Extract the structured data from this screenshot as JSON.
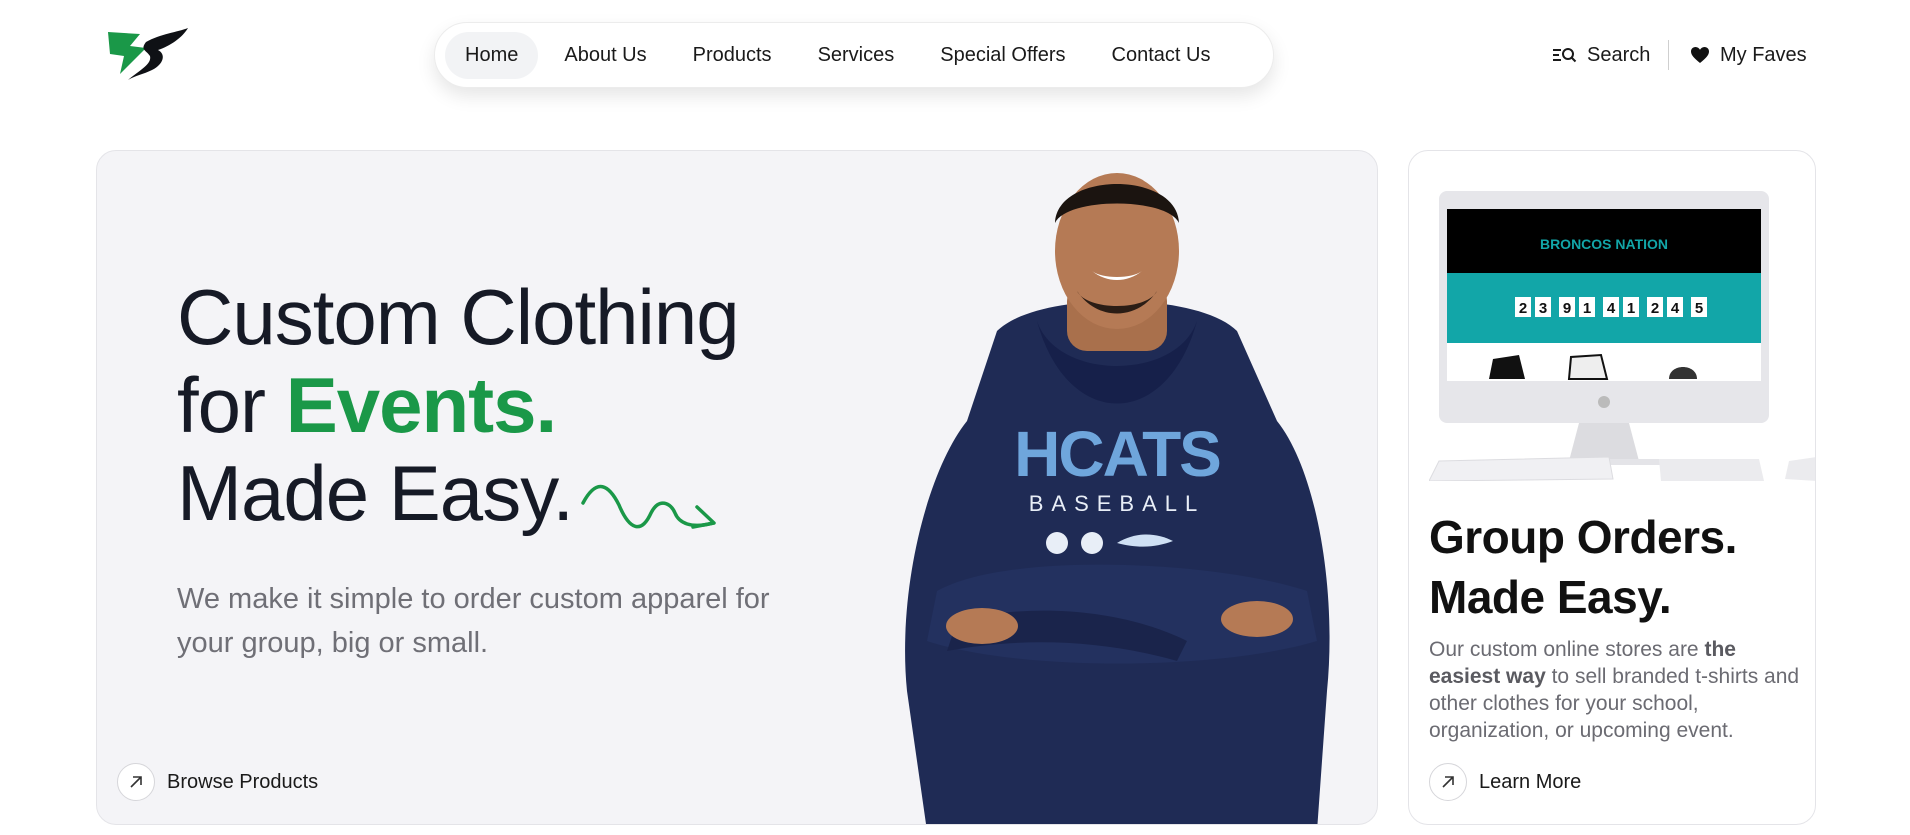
{
  "header": {
    "logo_icon": "bs-wing-logo",
    "nav": [
      {
        "label": "Home",
        "active": true
      },
      {
        "label": "About Us"
      },
      {
        "label": "Products"
      },
      {
        "label": "Services"
      },
      {
        "label": "Special Offers"
      },
      {
        "label": "Contact Us"
      }
    ],
    "search_label": "Search",
    "faves_label": "My Faves"
  },
  "hero": {
    "line1": "Custom Clothing",
    "line2_prefix": "for ",
    "line2_accent": "Events.",
    "line3": "Made Easy.",
    "subtext": "We make it simple to order custom apparel for your group, big or small.",
    "cta_label": "Browse Products",
    "model_shirt_text": "HCATS",
    "model_shirt_subtext": "BASEBALL"
  },
  "side": {
    "title_line1": "Group Orders.",
    "title_line2": "Made Easy.",
    "desc_1": "Our custom online stores are ",
    "desc_bold": "the easiest way",
    "desc_2": " to sell branded t-shirts and other clothes for your school, organization, or upcoming event.",
    "cta_label": "Learn More",
    "screen": {
      "brand": "BRONCOS NATION",
      "countdown": [
        "2",
        "3",
        "9",
        "1",
        "4",
        "1",
        "2",
        "4",
        "5"
      ]
    }
  },
  "colors": {
    "accent": "#1a9848",
    "navy": "#1e2a55",
    "teal": "#12a6a8"
  }
}
